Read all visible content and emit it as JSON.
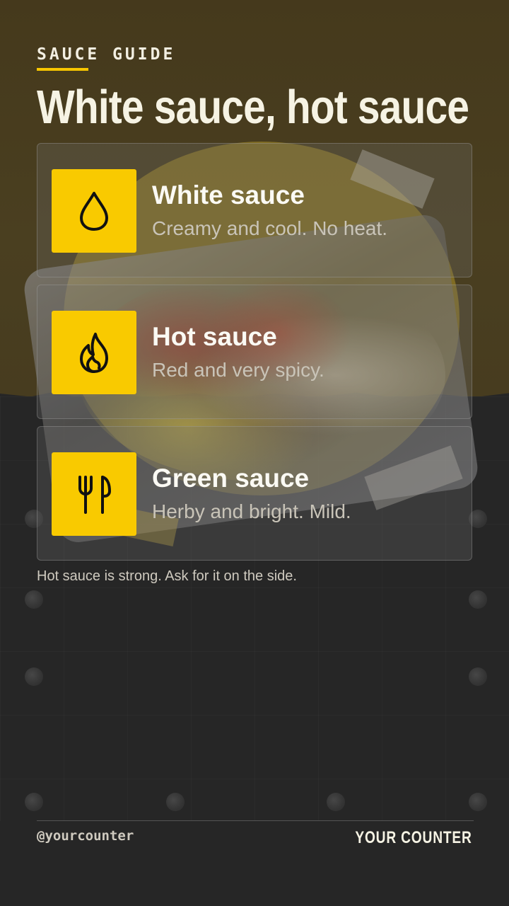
{
  "header": {
    "eyebrow": "SAUCE GUIDE",
    "title": "White sauce, hot sauce"
  },
  "sauces": [
    {
      "icon": "droplet-icon",
      "title": "White sauce",
      "description": "Creamy and cool. No heat."
    },
    {
      "icon": "flame-icon",
      "title": "Hot sauce",
      "description": "Red and very spicy."
    },
    {
      "icon": "fork-knife-icon",
      "title": "Green sauce",
      "description": "Herby and bright. Mild."
    }
  ],
  "note": "Hot sauce is strong. Ask for it on the side.",
  "footer": {
    "handle": "@yourcounter",
    "brand": "YOUR COUNTER"
  },
  "colors": {
    "accent": "#f9ca00",
    "background_top": "#45391c",
    "background_bottom": "#262626"
  }
}
